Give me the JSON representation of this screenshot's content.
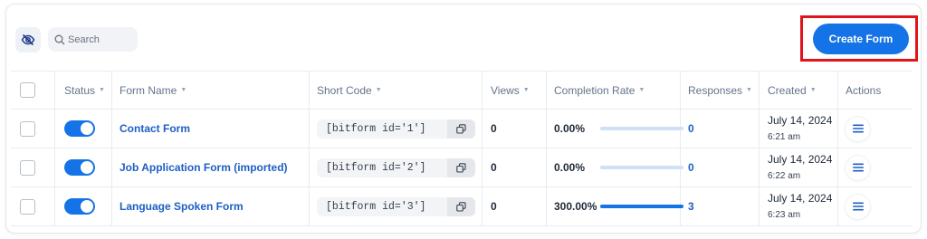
{
  "toolbar": {
    "search_placeholder": "Search",
    "create_button_label": "Create Form"
  },
  "table": {
    "headers": {
      "status": "Status",
      "form_name": "Form Name",
      "short_code": "Short Code",
      "views": "Views",
      "completion_rate": "Completion Rate",
      "responses": "Responses",
      "created": "Created",
      "actions": "Actions"
    },
    "rows": [
      {
        "enabled": true,
        "form_name": "Contact Form",
        "short_code": "[bitform id='1']",
        "views": "0",
        "completion_rate": "0.00%",
        "completion_fraction": 0,
        "responses": "0",
        "created_date": "July 14, 2024",
        "created_time": "6:21 am"
      },
      {
        "enabled": true,
        "form_name": "Job Application Form (imported)",
        "short_code": "[bitform id='2']",
        "views": "0",
        "completion_rate": "0.00%",
        "completion_fraction": 0,
        "responses": "0",
        "created_date": "July 14, 2024",
        "created_time": "6:22 am"
      },
      {
        "enabled": true,
        "form_name": "Language Spoken Form",
        "short_code": "[bitform id='3']",
        "views": "0",
        "completion_rate": "300.00%",
        "completion_fraction": 1,
        "responses": "3",
        "created_date": "July 14, 2024",
        "created_time": "6:23 am"
      }
    ]
  },
  "colors": {
    "accent": "#1473e6",
    "highlight_outline": "#e0151b"
  },
  "icons": {
    "visibility": "eye-off-icon",
    "search": "search-icon",
    "copy": "copy-icon",
    "actions": "menu-icon"
  }
}
